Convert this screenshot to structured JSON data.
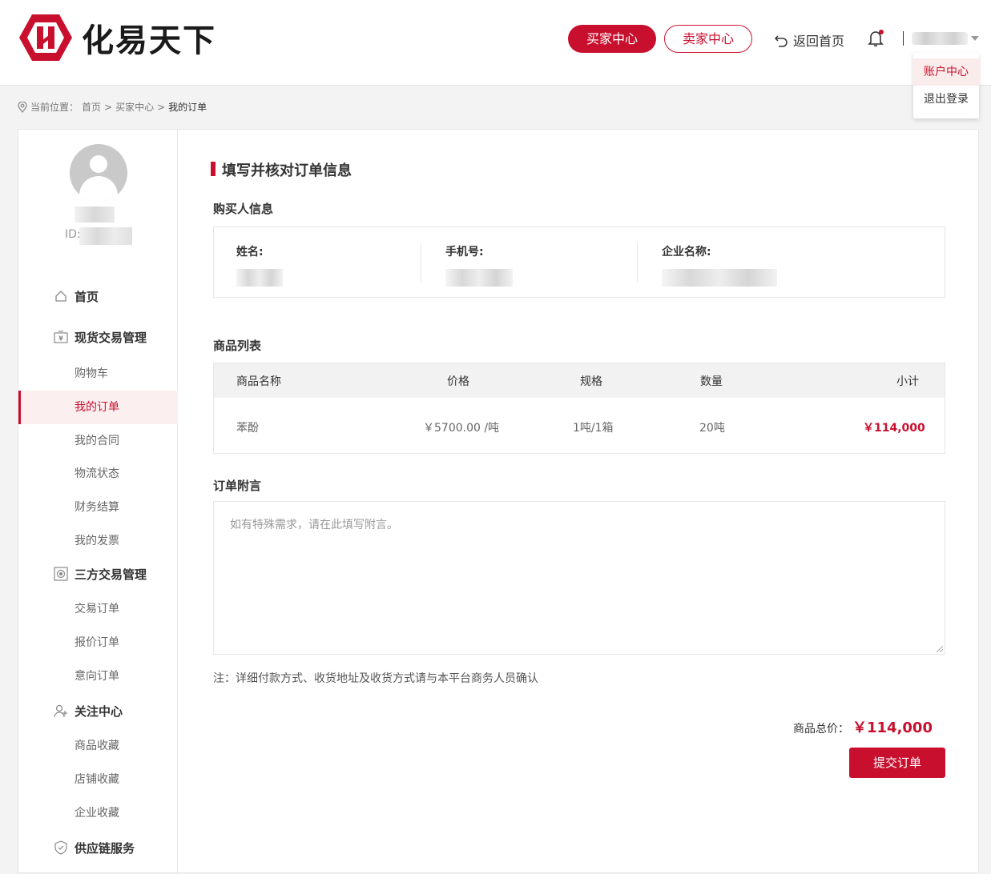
{
  "brand": {
    "name": "化易天下",
    "accent": "#c8102e"
  },
  "header": {
    "buyer_center": "买家中心",
    "seller_center": "卖家中心",
    "back_home": "返回首页",
    "dropdown": [
      "账户中心",
      "退出登录"
    ]
  },
  "breadcrumb": {
    "prefix": "当前位置：",
    "items": [
      "首页",
      "买家中心",
      "我的订单"
    ],
    "separator": ">"
  },
  "sidebar": {
    "id_label": "ID:",
    "home": "首页",
    "groups": [
      {
        "label": "现货交易管理",
        "icon": "yen-box-icon",
        "items": [
          "购物车",
          "我的订单",
          "我的合同",
          "物流状态",
          "财务结算",
          "我的发票"
        ]
      },
      {
        "label": "三方交易管理",
        "icon": "camera-box-icon",
        "items": [
          "交易订单",
          "报价订单",
          "意向订单"
        ]
      },
      {
        "label": "关注中心",
        "icon": "user-plus-icon",
        "items": [
          "商品收藏",
          "店铺收藏",
          "企业收藏"
        ]
      },
      {
        "label": "供应链服务",
        "icon": "shield-icon",
        "items": []
      }
    ],
    "active_item": "我的订单"
  },
  "main": {
    "title": "填写并核对订单信息",
    "buyer_section": "购买人信息",
    "buyer_fields": {
      "name": "姓名:",
      "phone": "手机号:",
      "company": "企业名称:"
    },
    "goods_section": "商品列表",
    "columns": [
      "商品名称",
      "价格",
      "规格",
      "数量",
      "小计"
    ],
    "rows": [
      {
        "name": "苯酚",
        "price": "￥5700.00 /吨",
        "spec": "1吨/1箱",
        "qty": "20吨",
        "subtotal": "￥114,000"
      }
    ],
    "remark_section": "订单附言",
    "remark_placeholder": "如有特殊需求，请在此填写附言。",
    "note": "注：详细付款方式、收货地址及收货方式请与本平台商务人员确认",
    "total_label": "商品总价：",
    "total_value": "￥114,000",
    "submit": "提交订单"
  }
}
